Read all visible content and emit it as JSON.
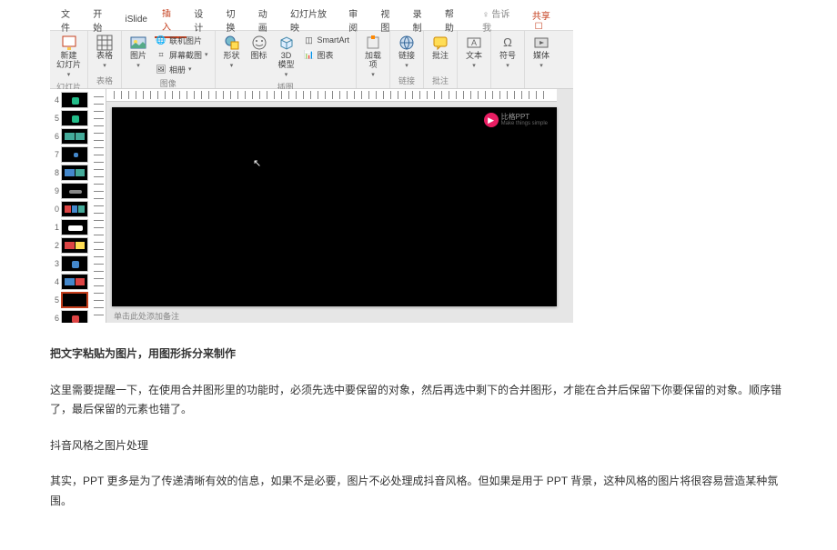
{
  "tabs": {
    "file": "文件",
    "home": "开始",
    "islide": "iSlide",
    "insert": "插入",
    "design": "设计",
    "transitions": "切换",
    "animations": "动画",
    "slideshow": "幻灯片放映",
    "review": "审阅",
    "view": "视图",
    "record": "录制",
    "help": "帮助",
    "tellme": "告诉我",
    "share": "共享"
  },
  "ribbon": {
    "new_slide": "新建\n幻灯片",
    "table": "表格",
    "pictures": "图片",
    "online_pictures": "联机图片",
    "screenshot": "屏幕截图",
    "photo_album": "相册",
    "shapes": "形状",
    "icons": "图标",
    "models3d": "3D\n模型",
    "smartart": "SmartArt",
    "chart": "图表",
    "addins": "加载\n项",
    "link": "链接",
    "comment": "批注",
    "textbox": "文本",
    "symbols": "符号",
    "media": "媒体",
    "group_slides": "幻灯片",
    "group_tables": "表格",
    "group_images": "图像",
    "group_illustrations": "插图",
    "group_links": "链接",
    "group_comments": "批注"
  },
  "thumbs": {
    "nums": [
      "4",
      "5",
      "6",
      "7",
      "8",
      "9",
      "0",
      "1",
      "2",
      "3",
      "4",
      "5",
      "6"
    ]
  },
  "canvas": {
    "logo_text": "比格PPT",
    "logo_sub": "Make things simple",
    "notes_placeholder": "单击此处添加备注"
  },
  "article": {
    "h1": "把文字粘贴为图片，用图形拆分来制作",
    "p1": "这里需要提醒一下，在使用合并图形里的功能时，必须先选中要保留的对象，然后再选中剩下的合并图形，才能在合并后保留下你要保留的对象。顺序错了，最后保留的元素也错了。",
    "p2": "抖音风格之图片处理",
    "p3": "其实，PPT 更多是为了传递清晰有效的信息，如果不是必要，图片不必处理成抖音风格。但如果是用于 PPT 背景，这种风格的图片将很容易营造某种氛围。"
  }
}
